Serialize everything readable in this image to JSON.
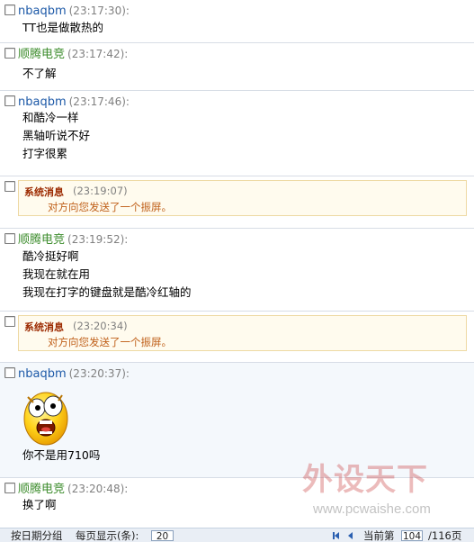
{
  "messages": [
    {
      "type": "user",
      "sender": "nbaqbm",
      "color": "blue",
      "time": "(23:17:30):",
      "lines": [
        "TT也是做散热的"
      ]
    },
    {
      "type": "user",
      "sender": "顺腾电竞",
      "color": "green",
      "time": "(23:17:42):",
      "lines": [
        "不了解"
      ]
    },
    {
      "type": "user",
      "sender": "nbaqbm",
      "color": "blue",
      "time": "(23:17:46):",
      "lines": [
        "和酷冷一样",
        "黑轴听说不好",
        "打字很累"
      ]
    },
    {
      "type": "system",
      "title": "系统消息",
      "time": "(23:19:07)",
      "text": "对方向您发送了一个振屏。"
    },
    {
      "type": "user",
      "sender": "顺腾电竞",
      "color": "green",
      "time": "(23:19:52):",
      "lines": [
        "酷冷挺好啊",
        "我现在就在用",
        "我现在打字的键盘就是酷冷红轴的"
      ]
    },
    {
      "type": "system",
      "title": "系统消息",
      "time": "(23:20:34)",
      "text": "对方向您发送了一个振屏。"
    },
    {
      "type": "user",
      "sender": "nbaqbm",
      "color": "blue",
      "time": "(23:20:37):",
      "emoji": "shocked-face-icon",
      "lines": [
        "你不是用710吗"
      ]
    },
    {
      "type": "user",
      "sender": "顺腾电竞",
      "color": "green",
      "time": "(23:20:48):",
      "lines": [
        "换了啊"
      ]
    }
  ],
  "watermark": {
    "text": "外设天下",
    "url": "www.pcwaishe.com"
  },
  "footer": {
    "group_label": "按日期分组",
    "per_page_label": "每页显示(条):",
    "per_page_value": "20",
    "current_page_label": "当前第",
    "current_page": "104",
    "total_pages": "/116页"
  },
  "colors": {
    "blue_name": "#1e5aa8",
    "green_name": "#3c8c2c",
    "system_title": "#9c2a00",
    "system_text": "#c0601a"
  }
}
